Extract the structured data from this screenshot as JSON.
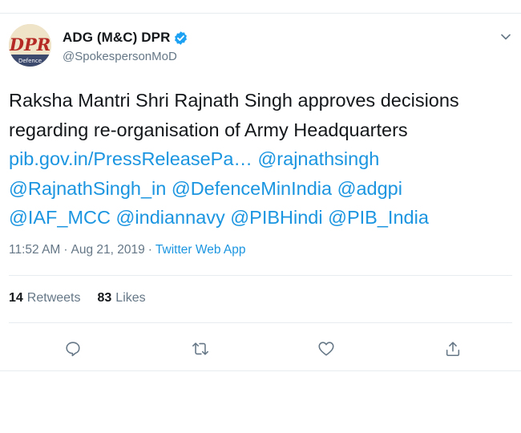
{
  "tweet": {
    "author": {
      "display_name": "ADG (M&C) DPR",
      "handle": "@SpokespersonMoD",
      "verified": true,
      "avatar_text": "DPR",
      "avatar_subtext": "Defence"
    },
    "text_lines": [
      [
        {
          "text": "Raksha Mantri Shri Rajnath Singh approves decisions",
          "link": false
        }
      ],
      [
        {
          "text": "regarding re-organisation of Army Headquarters",
          "link": false
        }
      ],
      [
        {
          "text": "pib.gov.in/PressReleasePa…",
          "link": true
        },
        {
          "text": " ",
          "link": false
        },
        {
          "text": "@rajnathsingh",
          "link": true
        }
      ],
      [
        {
          "text": "@RajnathSingh_in",
          "link": true
        },
        {
          "text": " ",
          "link": false
        },
        {
          "text": "@DefenceMinIndia",
          "link": true
        },
        {
          "text": " ",
          "link": false
        },
        {
          "text": "@adgpi",
          "link": true
        }
      ],
      [
        {
          "text": "@IAF_MCC",
          "link": true
        },
        {
          "text": " ",
          "link": false
        },
        {
          "text": "@indiannavy",
          "link": true
        },
        {
          "text": " ",
          "link": false
        },
        {
          "text": "@PIBHindi",
          "link": true
        },
        {
          "text": " ",
          "link": false
        },
        {
          "text": "@PIB_India",
          "link": true
        }
      ]
    ],
    "meta": {
      "time": "11:52 AM",
      "separator": "·",
      "date": "Aug 21, 2019",
      "source": "Twitter Web App"
    },
    "stats": {
      "retweets_count": "14",
      "retweets_label": "Retweets",
      "likes_count": "83",
      "likes_label": "Likes"
    },
    "actions": [
      {
        "name": "reply",
        "icon": "reply-icon"
      },
      {
        "name": "retweet",
        "icon": "retweet-icon"
      },
      {
        "name": "like",
        "icon": "heart-icon"
      },
      {
        "name": "share",
        "icon": "share-icon"
      }
    ]
  },
  "colors": {
    "link": "#1b95e0",
    "text": "#14171a",
    "secondary": "#657786",
    "divider": "#e6ecf0",
    "verified": "#1da1f2"
  }
}
